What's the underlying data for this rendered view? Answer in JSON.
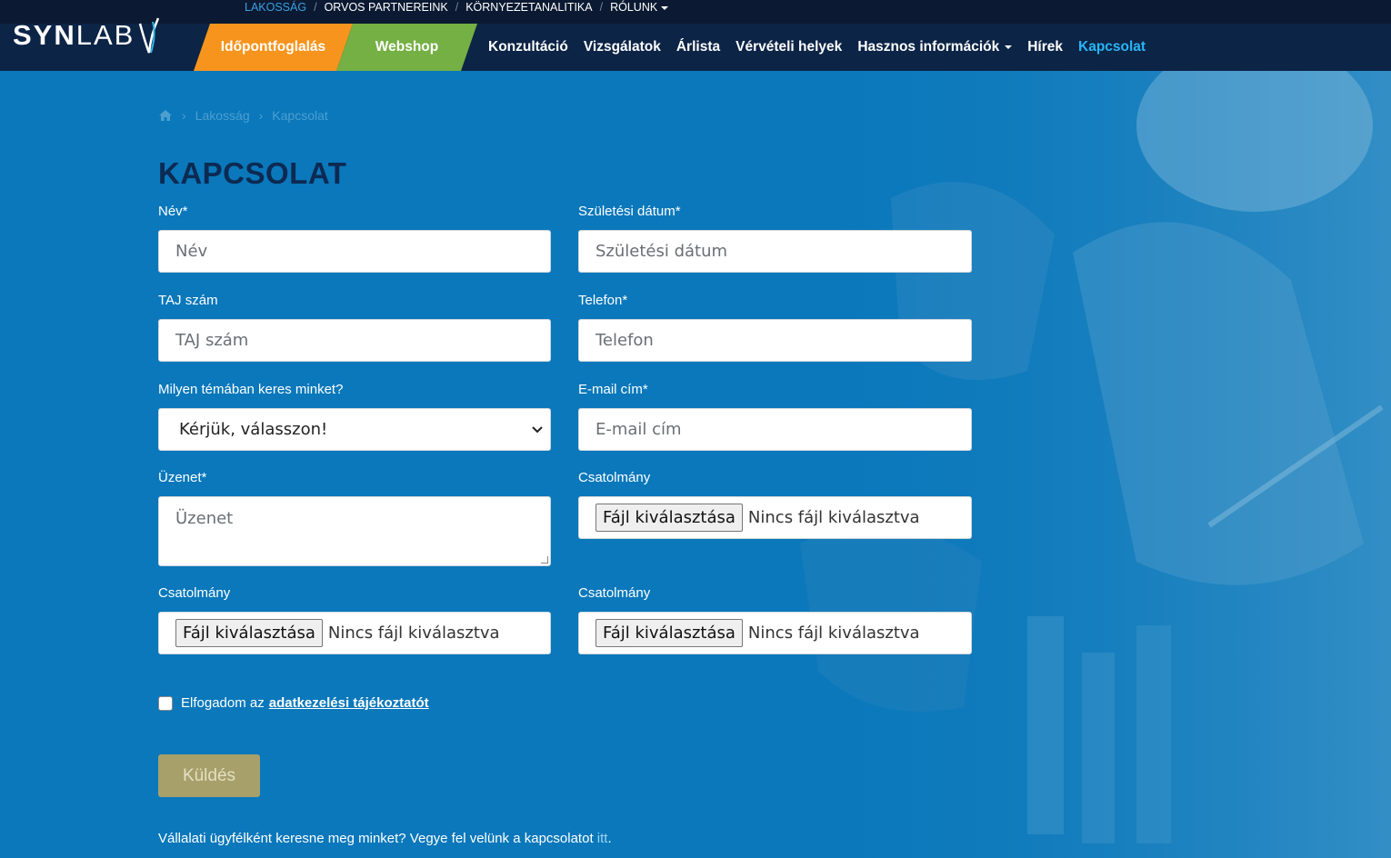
{
  "brand": {
    "logo_text_a": "SYN",
    "logo_text_b": "LAB"
  },
  "top_nav": {
    "items": [
      {
        "label": "LAKOSSÁG",
        "active": true
      },
      {
        "label": "ORVOS PARTNEREINK",
        "active": false
      },
      {
        "label": "KÖRNYEZETANALITIKA",
        "active": false
      },
      {
        "label": "RÓLUNK",
        "active": false
      }
    ],
    "separator": "/"
  },
  "main_nav": {
    "booking_label": "Időpontfoglalás",
    "webshop_label": "Webshop",
    "links": [
      {
        "label": "Konzultáció"
      },
      {
        "label": "Vizsgálatok"
      },
      {
        "label": "Árlista"
      },
      {
        "label": "Vérvételi helyek"
      },
      {
        "label": "Hasznos információk"
      },
      {
        "label": "Hírek"
      },
      {
        "label": "Kapcsolat"
      }
    ]
  },
  "breadcrumb": {
    "items": [
      "Lakosság",
      "Kapcsolat"
    ]
  },
  "page": {
    "title": "KAPCSOLAT"
  },
  "form": {
    "name": {
      "label": "Név*",
      "placeholder": "Név"
    },
    "birthdate": {
      "label": "Születési dátum*",
      "placeholder": "Születési dátum"
    },
    "taj": {
      "label": "TAJ szám",
      "placeholder": "TAJ szám"
    },
    "phone": {
      "label": "Telefon*",
      "placeholder": "Telefon"
    },
    "topic": {
      "label": "Milyen témában keres minket?",
      "selected": "Kérjük, válasszon!"
    },
    "email": {
      "label": "E-mail cím*",
      "placeholder": "E-mail cím"
    },
    "message": {
      "label": "Üzenet*",
      "placeholder": "Üzenet"
    },
    "attachment_1": {
      "label": "Csatolmány",
      "button": "Fájl kiválasztása",
      "status": "Nincs fájl kiválasztva"
    },
    "attachment_2": {
      "label": "Csatolmány",
      "button": "Fájl kiválasztása",
      "status": "Nincs fájl kiválasztva"
    },
    "attachment_3": {
      "label": "Csatolmány",
      "button": "Fájl kiválasztása",
      "status": "Nincs fájl kiválasztva"
    },
    "consent": {
      "text": "Elfogadom az",
      "link": "adatkezelési tájékoztatót",
      "checked": false
    },
    "submit_label": "Küldés"
  },
  "footer_note": {
    "text": "Vállalati ügyfélként keresne meg minket? Vegye fel velünk a kapcsolatot ",
    "link": "itt",
    "end": "."
  },
  "colors": {
    "background": "#0a78bb",
    "header": "#0c2446",
    "booking": "#f7941d",
    "webshop": "#74b043",
    "active_link": "#29b6f6",
    "title": "#0c2a52",
    "submit": "#a8a06a"
  }
}
